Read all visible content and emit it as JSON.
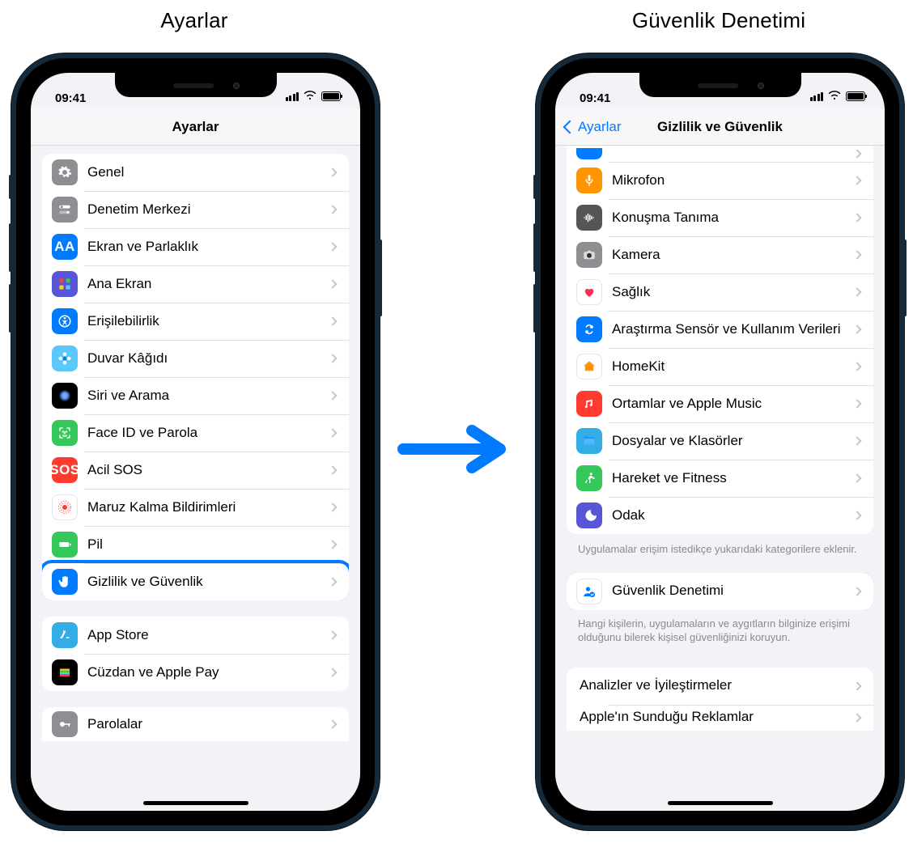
{
  "captions": {
    "left": "Ayarlar",
    "right": "Güvenlik Denetimi"
  },
  "status": {
    "time": "09:41"
  },
  "phone_left": {
    "nav_title": "Ayarlar",
    "group1": [
      {
        "key": "general",
        "label": "Genel",
        "icon": "gear-icon",
        "bg": "ic-gray"
      },
      {
        "key": "control-center",
        "label": "Denetim Merkezi",
        "icon": "switches-icon",
        "bg": "ic-gray"
      },
      {
        "key": "display",
        "label": "Ekran ve Parlaklık",
        "icon": "aa-icon",
        "bg": "ic-blue"
      },
      {
        "key": "home-screen",
        "label": "Ana Ekran",
        "icon": "grid-icon",
        "bg": "ic-indigo"
      },
      {
        "key": "accessibility",
        "label": "Erişilebilirlik",
        "icon": "accessibility-icon",
        "bg": "ic-blue"
      },
      {
        "key": "wallpaper",
        "label": "Duvar Kâğıdı",
        "icon": "flower-icon",
        "bg": "ic-lblue"
      },
      {
        "key": "siri",
        "label": "Siri ve Arama",
        "icon": "siri-icon",
        "bg": "ic-black"
      },
      {
        "key": "faceid",
        "label": "Face ID ve Parola",
        "icon": "faceid-icon",
        "bg": "ic-green"
      },
      {
        "key": "sos",
        "label": "Acil SOS",
        "icon": "sos-icon",
        "bg": "ic-red"
      },
      {
        "key": "exposure",
        "label": "Maruz Kalma Bildirimleri",
        "icon": "exposure-icon",
        "bg": "ic-white"
      },
      {
        "key": "battery",
        "label": "Pil",
        "icon": "battery-icon",
        "bg": "ic-green"
      },
      {
        "key": "privacy",
        "label": "Gizlilik ve Güvenlik",
        "icon": "hand-icon",
        "bg": "ic-blue",
        "highlight": true
      }
    ],
    "group2": [
      {
        "key": "appstore",
        "label": "App Store",
        "icon": "appstore-icon",
        "bg": "ic-sky"
      },
      {
        "key": "wallet",
        "label": "Cüzdan ve Apple Pay",
        "icon": "wallet-icon",
        "bg": "ic-black"
      }
    ],
    "group3": [
      {
        "key": "passwords",
        "label": "Parolalar",
        "icon": "key-icon",
        "bg": "ic-gray"
      }
    ]
  },
  "phone_right": {
    "nav_back": "Ayarlar",
    "nav_title": "Gizlilik ve Güvenlik",
    "group1": [
      {
        "key": "prev",
        "label": "",
        "icon": "",
        "bg": "ic-blue",
        "partial": true
      },
      {
        "key": "microphone",
        "label": "Mikrofon",
        "icon": "mic-icon",
        "bg": "ic-orange"
      },
      {
        "key": "speech",
        "label": "Konuşma Tanıma",
        "icon": "waveform-icon",
        "bg": "ic-dgray"
      },
      {
        "key": "camera",
        "label": "Kamera",
        "icon": "camera-icon",
        "bg": "ic-gray"
      },
      {
        "key": "health",
        "label": "Sağlık",
        "icon": "health-icon",
        "bg": "ic-white"
      },
      {
        "key": "research",
        "label": "Araştırma Sensör ve Kullanım Verileri",
        "icon": "research-icon",
        "bg": "ic-blue"
      },
      {
        "key": "homekit",
        "label": "HomeKit",
        "icon": "homekit-icon",
        "bg": "ic-white"
      },
      {
        "key": "media",
        "label": "Ortamlar ve Apple Music",
        "icon": "music-icon",
        "bg": "ic-red"
      },
      {
        "key": "files",
        "label": "Dosyalar ve Klasörler",
        "icon": "folder-icon",
        "bg": "ic-sky"
      },
      {
        "key": "motion",
        "label": "Hareket ve Fitness",
        "icon": "fitness-icon",
        "bg": "ic-green"
      },
      {
        "key": "focus",
        "label": "Odak",
        "icon": "focus-icon",
        "bg": "ic-purple"
      }
    ],
    "footer1": "Uygulamalar erişim istedikçe yukarıdaki kategorilere eklenir.",
    "safety": {
      "label": "Güvenlik Denetimi",
      "icon": "person-check-icon",
      "bg": "ic-white"
    },
    "footer2": "Hangi kişilerin, uygulamaların ve aygıtların bilginize erişimi olduğunu bilerek kişisel güvenliğinizi koruyun.",
    "group3": [
      {
        "key": "analytics",
        "label": "Analizler ve İyileştirmeler",
        "icon": "",
        "bg": ""
      },
      {
        "key": "apple-ads",
        "label": "Apple'ın Sunduğu Reklamlar",
        "icon": "",
        "bg": ""
      }
    ]
  }
}
